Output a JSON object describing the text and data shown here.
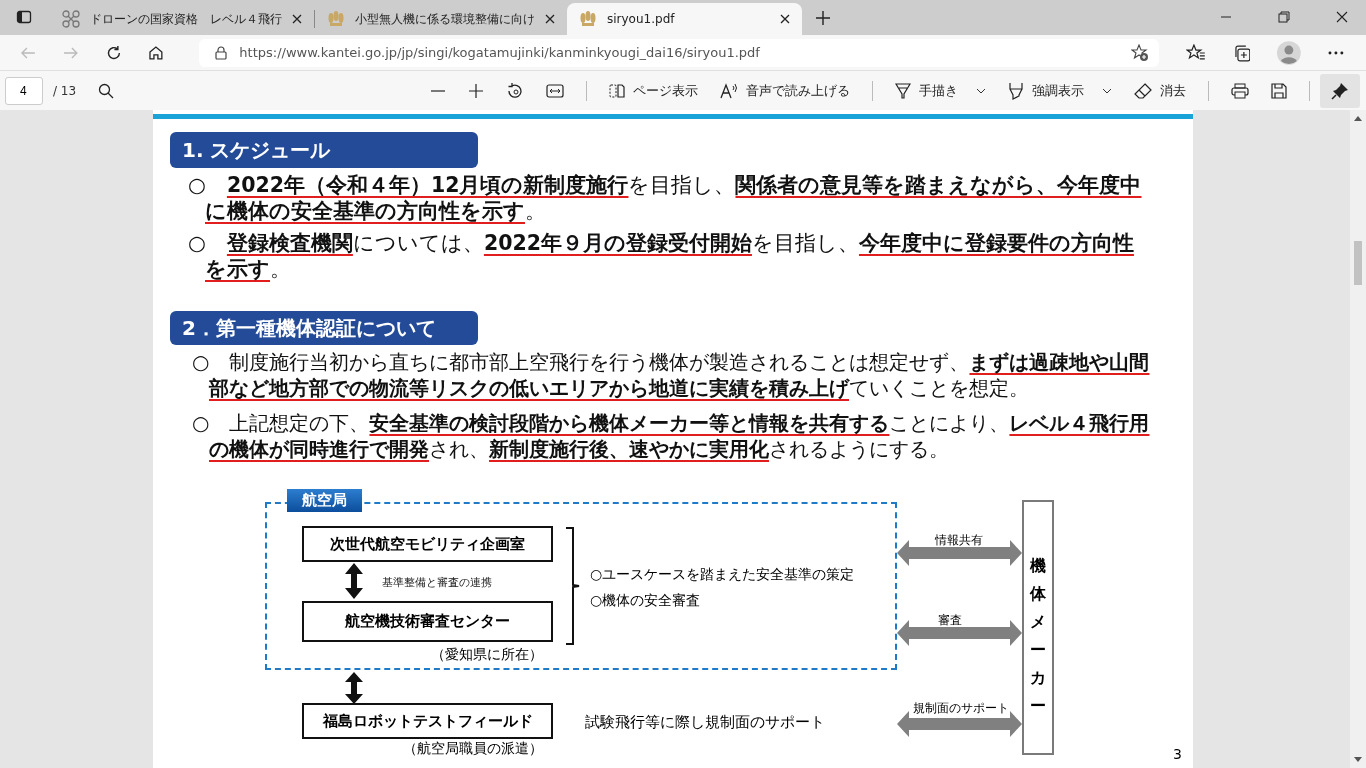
{
  "browser": {
    "tabs": [
      {
        "title": "ドローンの国家資格　レベル４飛行",
        "kind": "drone",
        "selected": false
      },
      {
        "title": "小型無人機に係る環境整備に向け",
        "kind": "emblem",
        "selected": false
      },
      {
        "title": "siryou1.pdf",
        "kind": "emblem",
        "selected": true
      }
    ],
    "url": "https://www.kantei.go.jp/jp/singi/kogatamujinki/kanminkyougi_dai16/siryou1.pdf"
  },
  "pdf_toolbar": {
    "page": "4",
    "page_count": "/ 13",
    "pinned": true,
    "buttons": [
      {
        "kind": "page-view",
        "label": "ページ表示",
        "dropdown": false
      },
      {
        "kind": "read-aloud",
        "label": "音声で読み上げる",
        "dropdown": false
      },
      {
        "kind": "draw",
        "label": "手描き",
        "dropdown": true
      },
      {
        "kind": "highlight",
        "label": "強調表示",
        "dropdown": true
      },
      {
        "kind": "erase",
        "label": "消去",
        "dropdown": false
      }
    ]
  },
  "document": {
    "sections": [
      {
        "title": "1. スケジュール",
        "paragraphs": [
          "○　**2022年（令和４年）12月頃の新制度施行**を目指し、**関係者の意見等を踏まえながら、今年度中に機体の安全基準の方向性を示す**。",
          "○　**登録検査機関**については、**2022年９月の登録受付開始**を目指し、**今年度中に登録要件の方向性を示す**。"
        ]
      },
      {
        "title": "2．第一種機体認証について",
        "paragraphs": [
          "○　制度施行当初から直ちに都市部上空飛行を行う機体が製造されることは想定せず、**まずは過疎地や山間部など地方部での物流等リスクの低いエリアから地道に実績を積み上げ**ていくことを想定。",
          "○　上記想定の下、**安全基準の検討段階から機体メーカー等と情報を共有する**ことにより、**レベル４飛行用の機体が同時進行で開発**され、**新制度施行後、速やかに実用化**されるようにする。"
        ]
      }
    ],
    "diagram": {
      "group_label": "航空局",
      "top_box": "次世代航空モビリティ企画室",
      "link_label": "基準整備と審査の連携",
      "center_box": "航空機技術審査センター",
      "center_note": "（愛知県に所在）",
      "roles": [
        "○ユースケースを踏まえた安全基準の策定",
        "○機体の安全審査"
      ],
      "field_box": "福島ロボットテストフィールド",
      "field_note": "（航空局職員の派遣）",
      "field_role": "試験飛行等に際し規制面のサポート",
      "links": [
        {
          "label": "情報共有"
        },
        {
          "label": "審査"
        },
        {
          "label": "規制面のサポート"
        }
      ],
      "maker": "機体メーカー"
    },
    "page_number": "3"
  }
}
